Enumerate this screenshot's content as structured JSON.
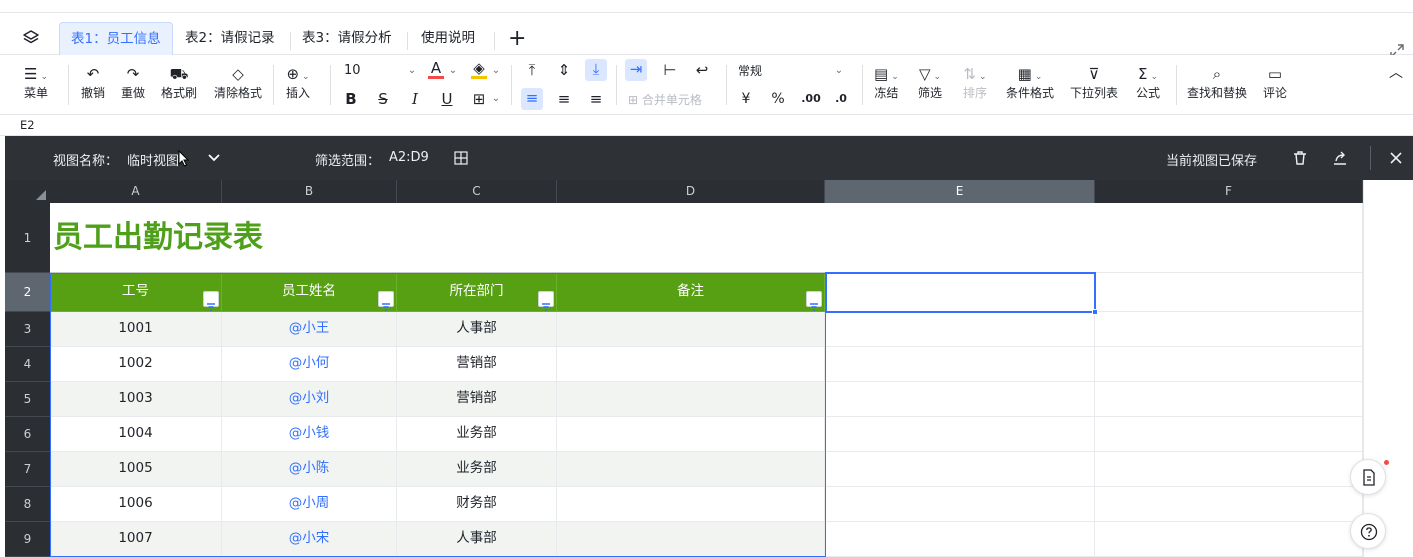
{
  "tabs": [
    {
      "label": "表1：员工信息",
      "active": true
    },
    {
      "label": "表2：请假记录",
      "active": false
    },
    {
      "label": "表3：请假分析",
      "active": false
    },
    {
      "label": "使用说明",
      "active": false
    }
  ],
  "add_tab_label": "+",
  "toolbar": {
    "menu": "菜单",
    "undo": "撤销",
    "redo": "重做",
    "format_painter": "格式刷",
    "clear_format": "清除格式",
    "insert": "插入",
    "font_size": "10",
    "bold": "B",
    "strike": "S",
    "italic": "I",
    "underline": "U",
    "font_color_glyph": "A",
    "merge_cells": "合并单元格",
    "number_format": "常规",
    "currency": "¥",
    "percent": "%",
    "decimal_increase": ".00",
    "decimal_decrease": ".0",
    "freeze": "冻结",
    "filter": "筛选",
    "sort": "排序",
    "conditional_format": "条件格式",
    "dropdown_list": "下拉列表",
    "formula": "公式",
    "find_replace": "查找和替换",
    "comment": "评论"
  },
  "cell_ref": "E2",
  "view_bar": {
    "name_label": "视图名称：",
    "name_value": "临时视图",
    "range_label": "筛选范围：",
    "range_value": "A2:D9",
    "saved_status": "当前视图已保存"
  },
  "columns": [
    "A",
    "B",
    "C",
    "D",
    "E",
    "F"
  ],
  "rows": [
    "1",
    "2",
    "3",
    "4",
    "5",
    "6",
    "7",
    "8",
    "9"
  ],
  "sheet": {
    "title": "员工出勤记录表",
    "headers": [
      "工号",
      "员工姓名",
      "所在部门",
      "备注"
    ],
    "data": [
      [
        "1001",
        "@小王",
        "人事部",
        ""
      ],
      [
        "1002",
        "@小何",
        "营销部",
        ""
      ],
      [
        "1003",
        "@小刘",
        "营销部",
        ""
      ],
      [
        "1004",
        "@小钱",
        "业务部",
        ""
      ],
      [
        "1005",
        "@小陈",
        "业务部",
        ""
      ],
      [
        "1006",
        "@小周",
        "财务部",
        ""
      ],
      [
        "1007",
        "@小宋",
        "人事部",
        ""
      ]
    ]
  },
  "colors": {
    "header_green": "#58a013",
    "title_green": "#4ea01a",
    "accent_blue": "#3370ff",
    "view_bar_bg": "#2e3236"
  }
}
